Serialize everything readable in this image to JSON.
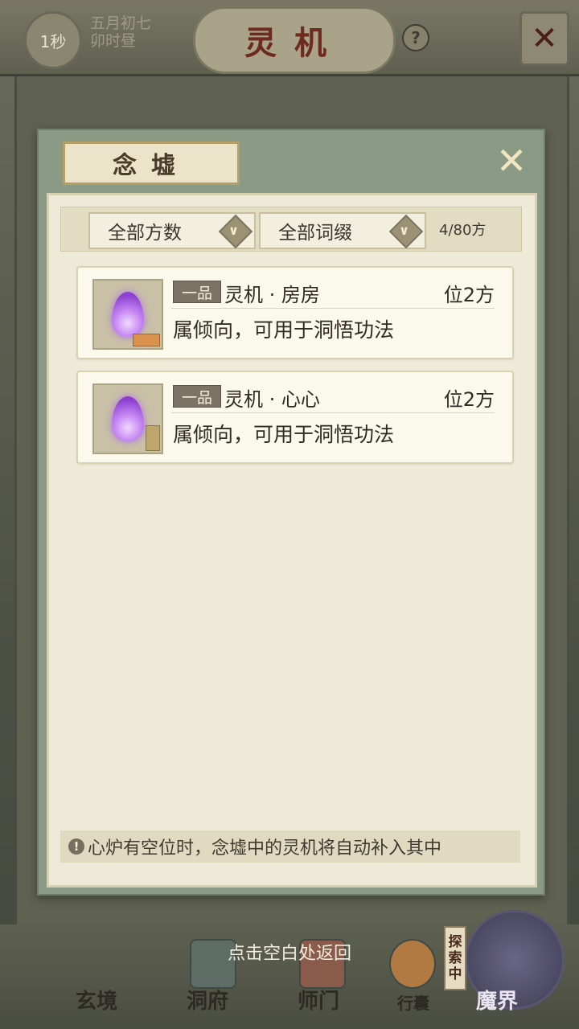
{
  "topbar": {
    "time": "1秒",
    "date_line1": "五月初七",
    "date_line2": "卯时昼",
    "title": "灵机",
    "help": "?",
    "close_symbol": "✕"
  },
  "dialog": {
    "tab_title": "念墟",
    "close_symbol": "✕",
    "filter": {
      "dropdown1": "全部方数",
      "dropdown2": "全部词缀",
      "count": "4/80方"
    },
    "items": [
      {
        "grade": "一品",
        "name": "灵机 · 房房",
        "position": "位2方",
        "desc": "属倾向，可用于洞悟功法",
        "icon": "purple-flame-icon"
      },
      {
        "grade": "一品",
        "name": "灵机 · 心心",
        "position": "位2方",
        "desc": "属倾向，可用于洞悟功法",
        "icon": "purple-flame-icon"
      }
    ],
    "tip": "心炉有空位时，念墟中的灵机将自动补入其中",
    "tip_icon": "!"
  },
  "bottom": {
    "return_hint": "点击空白处返回",
    "nav": [
      "玄境",
      "洞府",
      "师门",
      "行囊",
      "魔界"
    ],
    "explore_tag": [
      "探",
      "索",
      "中"
    ]
  },
  "colors": {
    "accent": "#6e2a1e",
    "panel": "#eeead8",
    "dialog_frame": "#8b9a84",
    "flame": "#b070e8"
  }
}
